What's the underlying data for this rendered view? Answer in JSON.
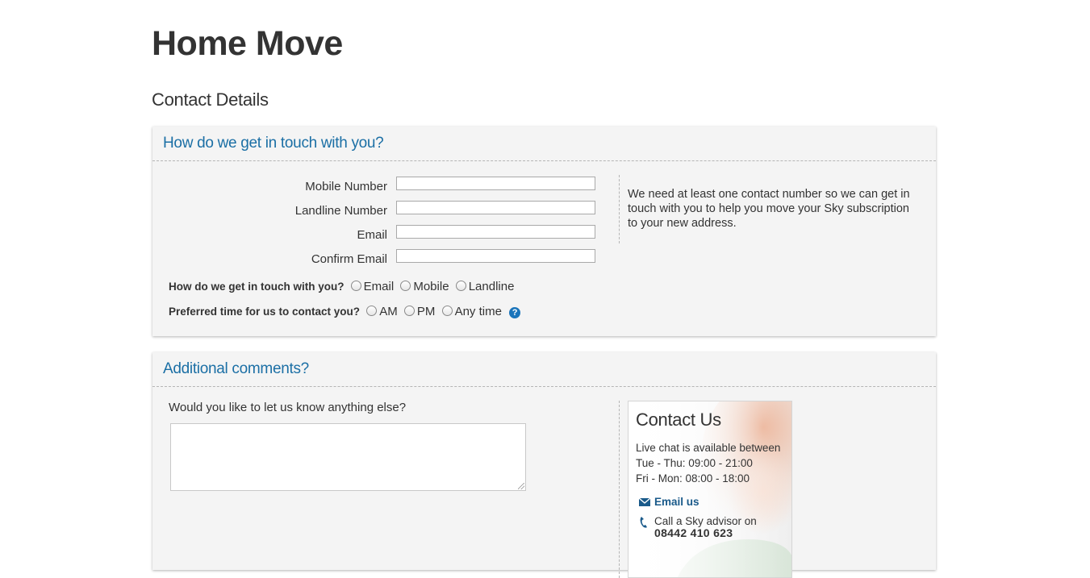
{
  "page": {
    "title": "Home Move",
    "subtitle": "Contact Details"
  },
  "contact_panel": {
    "heading": "How do we get in touch with you?",
    "fields": [
      {
        "label": "Mobile Number",
        "value": ""
      },
      {
        "label": "Landline Number",
        "value": ""
      },
      {
        "label": "Email",
        "value": ""
      },
      {
        "label": "Confirm Email",
        "value": ""
      }
    ],
    "help_text": "We need at least one contact number so we can get in touch with you to help you move your Sky subscription to your new address.",
    "contact_method": {
      "question": "How do we get in touch with you?",
      "options": [
        "Email",
        "Mobile",
        "Landline"
      ]
    },
    "preferred_time": {
      "question": "Preferred time for us to contact you?",
      "options": [
        "AM",
        "PM",
        "Any time"
      ],
      "help_icon": "?"
    }
  },
  "comments_panel": {
    "heading": "Additional comments?",
    "question": "Would you like to let us know anything else?",
    "comments_value": ""
  },
  "contact_card": {
    "title": "Contact Us",
    "chat_intro": "Live chat is available between",
    "hours_1": "Tue - Thu: 09:00 - 21:00",
    "hours_2": "Fri - Mon: 08:00 - 18:00",
    "email_link": "Email us",
    "call_text": "Call a Sky advisor on",
    "phone_number": "08442 410 623"
  },
  "colors": {
    "accent": "#1b6fa5",
    "panel_bg": "#f4f4f4",
    "help_icon": "#1b75bb"
  },
  "icons": [
    "help-icon",
    "envelope-icon",
    "phone-icon"
  ]
}
